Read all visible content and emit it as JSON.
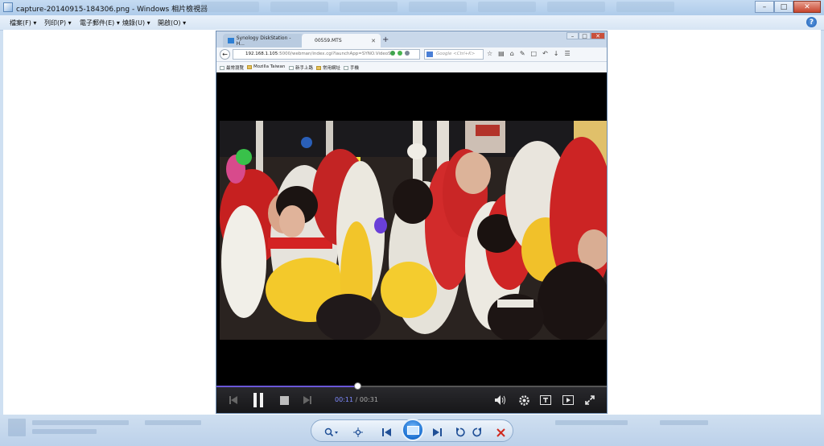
{
  "window": {
    "title": "capture-20140915-184306.png - Windows 相片檢視器"
  },
  "menu": {
    "items": [
      "檔案(F)",
      "列印(P)",
      "電子郵件(E)",
      "燒錄(U)",
      "開啟(O)"
    ],
    "help": "?"
  },
  "browser": {
    "tabs": [
      {
        "label": "Synology DiskStation - H..."
      },
      {
        "label": "00559.MTS"
      }
    ],
    "url_host": "192.168.1.105",
    "url_rest": ":5000/webman/index.cgi?launchApp=SYNO.VideoS",
    "search_placeholder": "Google <Ctrl+K>",
    "bookmarks": [
      "最常瀏覽",
      "Mozilla Taiwan",
      "新手上路",
      "常用網址",
      "手機"
    ]
  },
  "player": {
    "time_current": "00:11",
    "time_separator": "/",
    "time_total": "00:31",
    "progress": 0.36
  },
  "icons": {
    "help": "help-icon",
    "zoom": "zoom-icon",
    "fit": "actual-size-icon",
    "prev": "previous-icon",
    "slideshow": "slideshow-icon",
    "next": "next-icon",
    "rotate_ccw": "rotate-ccw-icon",
    "rotate_cw": "rotate-cw-icon",
    "delete": "delete-icon"
  }
}
